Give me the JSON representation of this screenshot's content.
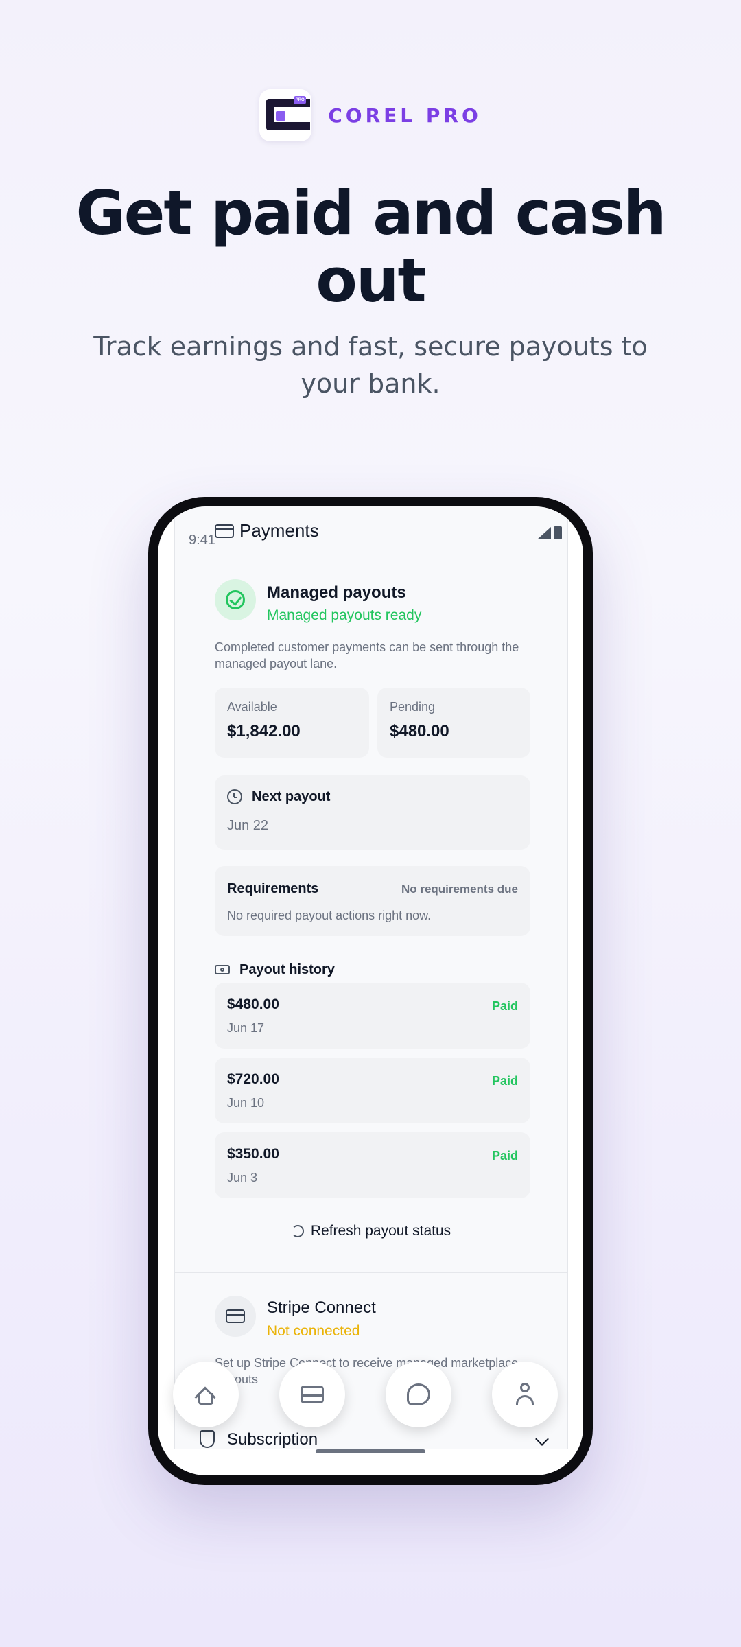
{
  "brand": {
    "name": "COREL PRO"
  },
  "hero": {
    "headline": "Get paid and cash out",
    "subhead": "Track earnings and fast, secure payouts to your bank."
  },
  "status_bar": {
    "time": "9:41"
  },
  "topbar": {
    "title": "Payments"
  },
  "managed": {
    "title": "Managed payouts",
    "status": "Managed payouts ready",
    "description": "Completed customer payments can be sent through the managed payout lane."
  },
  "balances": {
    "available_label": "Available",
    "available_value": "$1,842.00",
    "pending_label": "Pending",
    "pending_value": "$480.00"
  },
  "next_payout": {
    "title": "Next payout",
    "date": "Jun 22"
  },
  "requirements": {
    "title": "Requirements",
    "badge": "No requirements due",
    "text": "No required payout actions right now."
  },
  "history": {
    "title": "Payout history",
    "items": [
      {
        "amount": "$480.00",
        "date": "Jun 17",
        "status": "Paid"
      },
      {
        "amount": "$720.00",
        "date": "Jun 10",
        "status": "Paid"
      },
      {
        "amount": "$350.00",
        "date": "Jun 3",
        "status": "Paid"
      }
    ]
  },
  "refresh": {
    "label": "Refresh payout status"
  },
  "stripe": {
    "title": "Stripe Connect",
    "status": "Not connected",
    "description": "Set up Stripe Connect to receive managed marketplace payouts"
  },
  "subscription": {
    "title": "Subscription"
  },
  "colors": {
    "accent": "#7b3fe4",
    "success": "#22c55e",
    "warning": "#eab308"
  },
  "nav": {
    "icons": [
      "home-icon",
      "inbox-icon",
      "chat-icon",
      "user-icon"
    ]
  }
}
